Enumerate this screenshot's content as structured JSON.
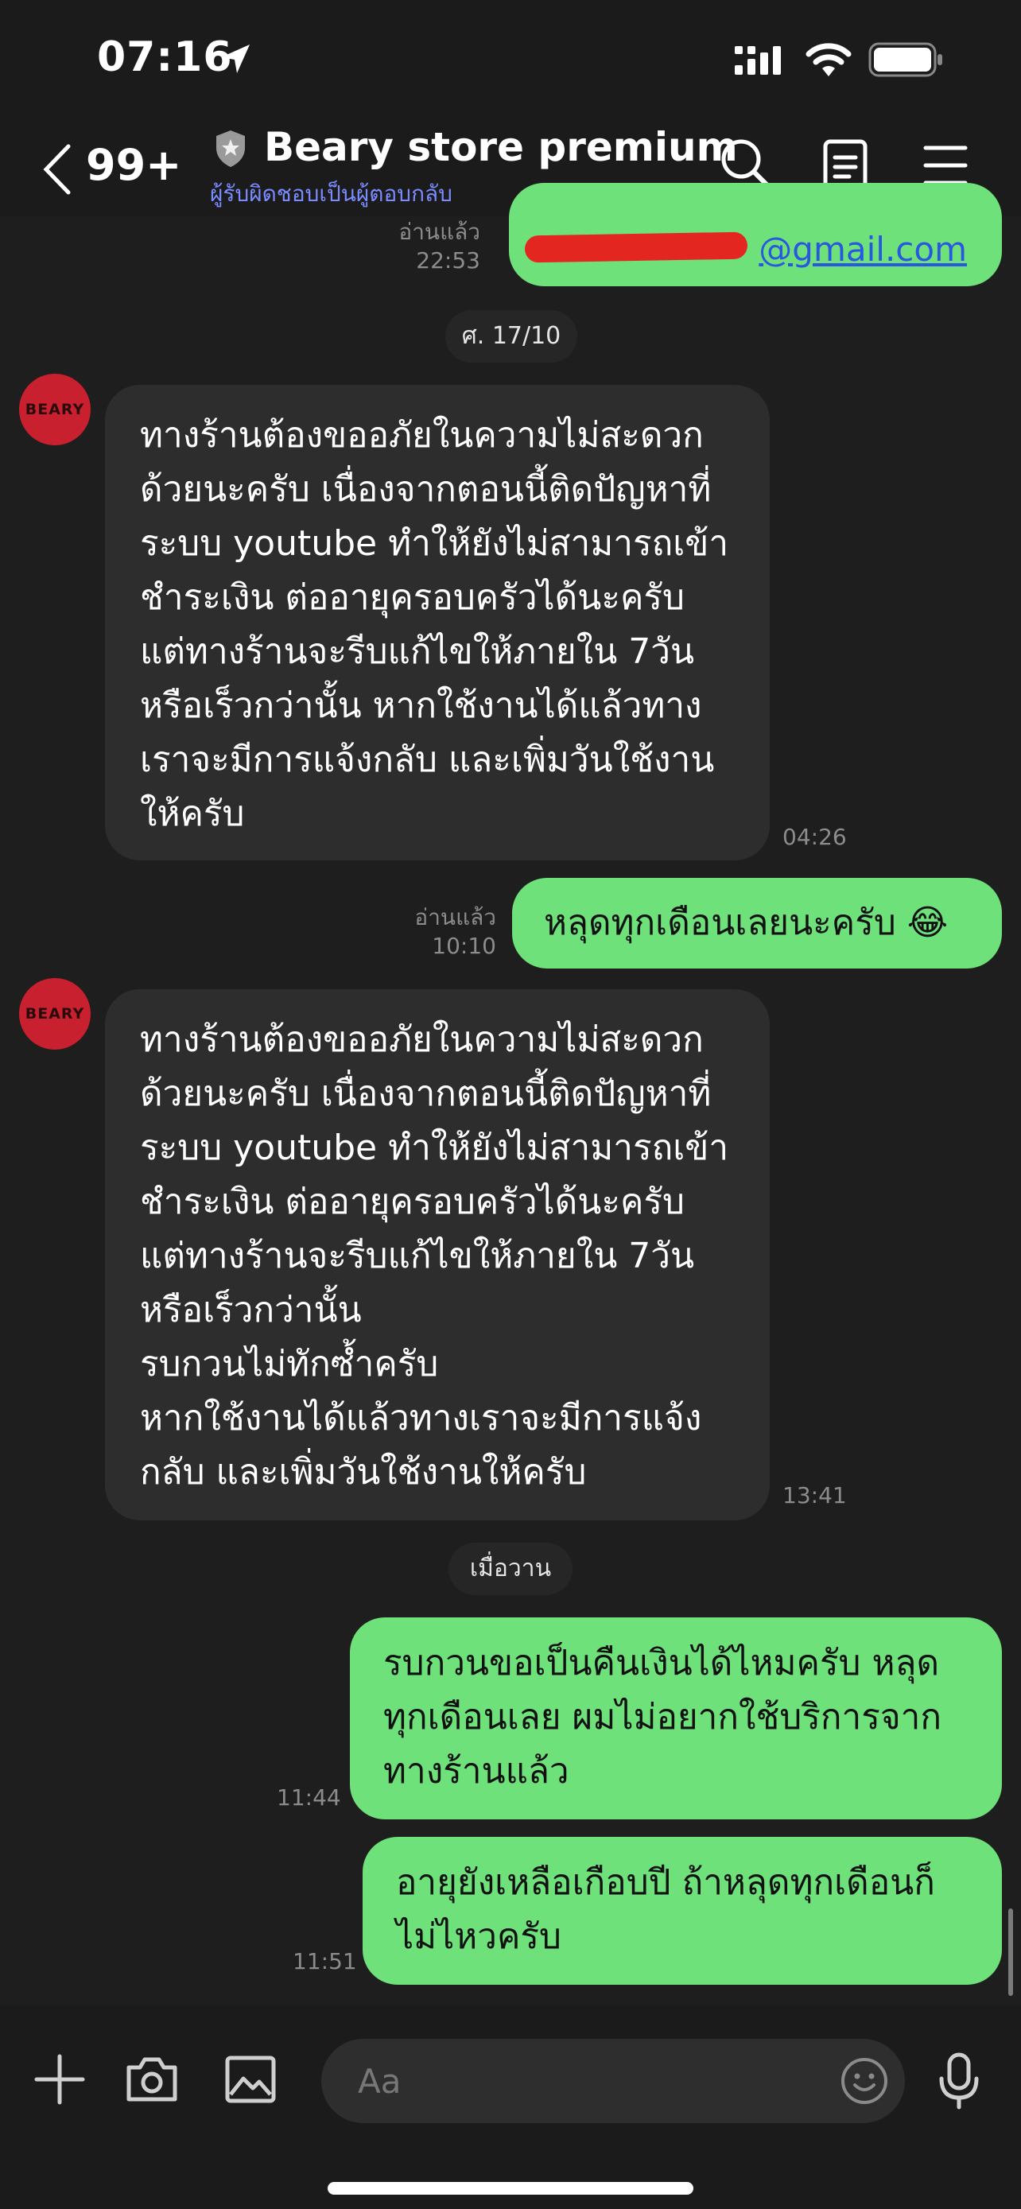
{
  "status_bar": {
    "time": "07:16"
  },
  "header": {
    "back_count": "99+",
    "title": "Beary store premium",
    "subtitle": "ผู้รับผิดชอบเป็นผู้ตอบกลับ"
  },
  "messages": [
    {
      "from": "me",
      "email_visible": "@gmail.com",
      "read_label": "อ่านแล้ว",
      "time": "22:53"
    },
    {
      "type": "date",
      "label": "ศ. 17/10"
    },
    {
      "from": "store",
      "avatar_text": "BEARY",
      "text": "ทางร้านต้องขออภัยในความไม่สะดวก\nด้วยนะครับ เนื่องจากตอนนี้ติดปัญหาที่\nระบบ youtube ทำให้ยังไม่สามารถเข้า\nชำระเงิน ต่ออายุครอบครัวได้นะครับ\nแต่ทางร้านจะรีบแก้ไขให้ภายใน 7วัน\nหรือเร็วกว่านั้น หากใช้งานได้แล้วทาง\nเราจะมีการแจ้งกลับ และเพิ่มวันใช้งาน\nให้ครับ",
      "time": "04:26"
    },
    {
      "from": "me",
      "text": "หลุดทุกเดือนเลยนะครับ 😂",
      "read_label": "อ่านแล้ว",
      "time": "10:10"
    },
    {
      "from": "store",
      "avatar_text": "BEARY",
      "text": "ทางร้านต้องขออภัยในความไม่สะดวก\nด้วยนะครับ เนื่องจากตอนนี้ติดปัญหาที่\nระบบ youtube ทำให้ยังไม่สามารถเข้า\nชำระเงิน ต่ออายุครอบครัวได้นะครับ\nแต่ทางร้านจะรีบแก้ไขให้ภายใน 7วัน\nหรือเร็วกว่านั้น\nรบกวนไม่ทักซ้ำครับ\nหากใช้งานได้แล้วทางเราจะมีการแจ้ง\nกลับ และเพิ่มวันใช้งานให้ครับ",
      "time": "13:41"
    },
    {
      "type": "date",
      "label": "เมื่อวาน"
    },
    {
      "from": "me",
      "text": "รบกวนขอเป็นคืนเงินได้ไหมครับ หลุด\nทุกเดือนเลย ผมไม่อยากใช้บริการจาก\nทางร้านแล้ว",
      "time": "11:44"
    },
    {
      "from": "me",
      "text": "อายุยังเหลือเกือบปี ถ้าหลุดทุกเดือนก็\nไม่ไหวครับ",
      "time": "11:51"
    }
  ],
  "input": {
    "placeholder": "Aa"
  },
  "colors": {
    "outgoing": "#6ee17a",
    "incoming": "#2d2d2d",
    "background": "#1e1e1e",
    "subtitle": "#7a8cff"
  }
}
